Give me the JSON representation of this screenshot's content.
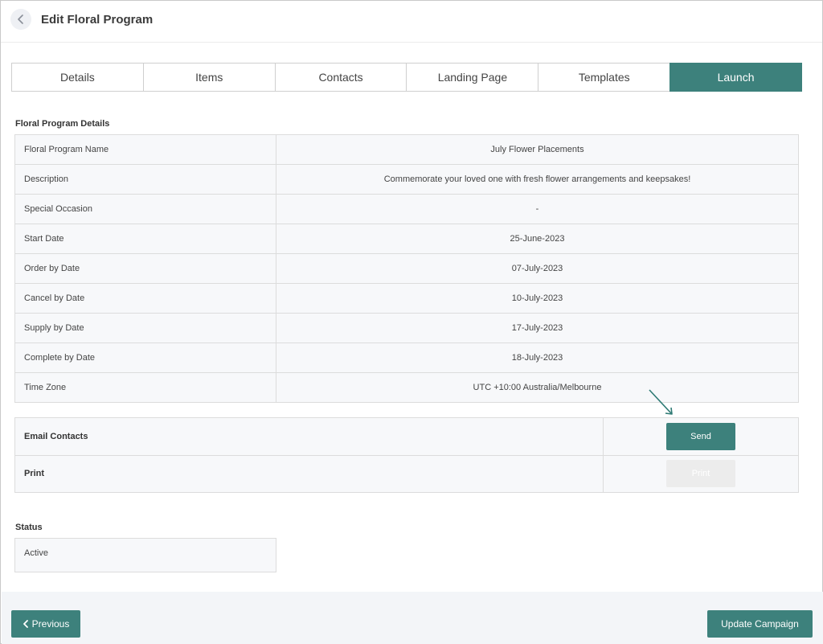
{
  "header": {
    "title": "Edit Floral Program",
    "back_icon": "chevron-left-icon"
  },
  "tabs": [
    {
      "label": "Details",
      "active": false
    },
    {
      "label": "Items",
      "active": false
    },
    {
      "label": "Contacts",
      "active": false
    },
    {
      "label": "Landing Page",
      "active": false
    },
    {
      "label": "Templates",
      "active": false
    },
    {
      "label": "Launch",
      "active": true
    }
  ],
  "details": {
    "section_title": "Floral Program Details",
    "rows": [
      {
        "label": "Floral Program Name",
        "value": "July Flower Placements"
      },
      {
        "label": "Description",
        "value": "Commemorate your loved one with fresh flower arrangements and keepsakes!"
      },
      {
        "label": "Special Occasion",
        "value": "-"
      },
      {
        "label": "Start Date",
        "value": "25-June-2023"
      },
      {
        "label": "Order by Date",
        "value": "07-July-2023"
      },
      {
        "label": "Cancel by Date",
        "value": "10-July-2023"
      },
      {
        "label": "Supply by Date",
        "value": "17-July-2023"
      },
      {
        "label": "Complete by Date",
        "value": "18-July-2023"
      },
      {
        "label": "Time Zone",
        "value": "UTC +10:00 Australia/Melbourne"
      }
    ]
  },
  "actions": {
    "email_label": "Email Contacts",
    "send_label": "Send",
    "print_label": "Print",
    "print_button_label": "Print"
  },
  "status": {
    "section_title": "Status",
    "value": "Active"
  },
  "footer": {
    "previous_label": "Previous",
    "update_label": "Update Campaign"
  },
  "colors": {
    "accent": "#3d817c",
    "disabled": "#ececec",
    "row_bg": "#f7f8fa"
  }
}
